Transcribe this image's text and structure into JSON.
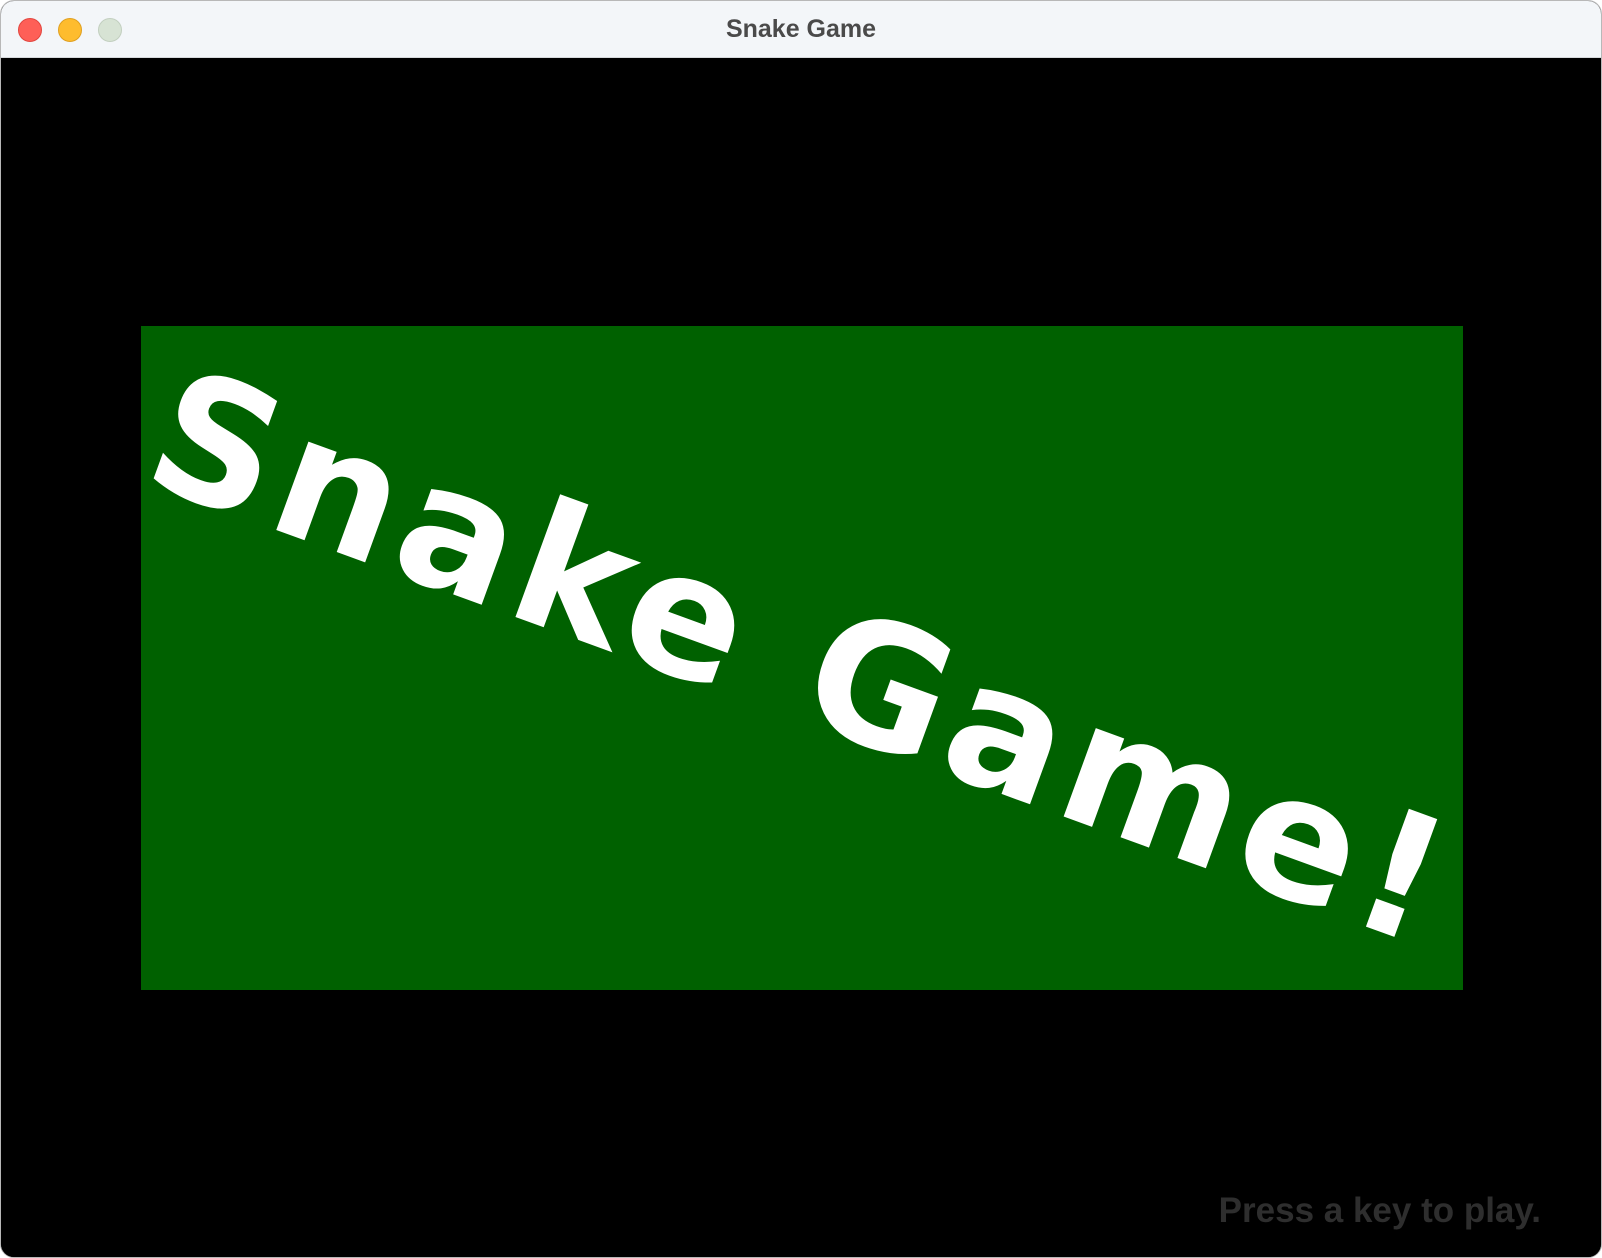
{
  "window": {
    "title": "Snake Game"
  },
  "game": {
    "banner_text": "Snake Game!",
    "prompt": "Press a key to play.",
    "colors": {
      "background": "#000000",
      "banner": "#006100",
      "banner_text": "#ffffff",
      "prompt_text": "#2e2e2e"
    }
  }
}
